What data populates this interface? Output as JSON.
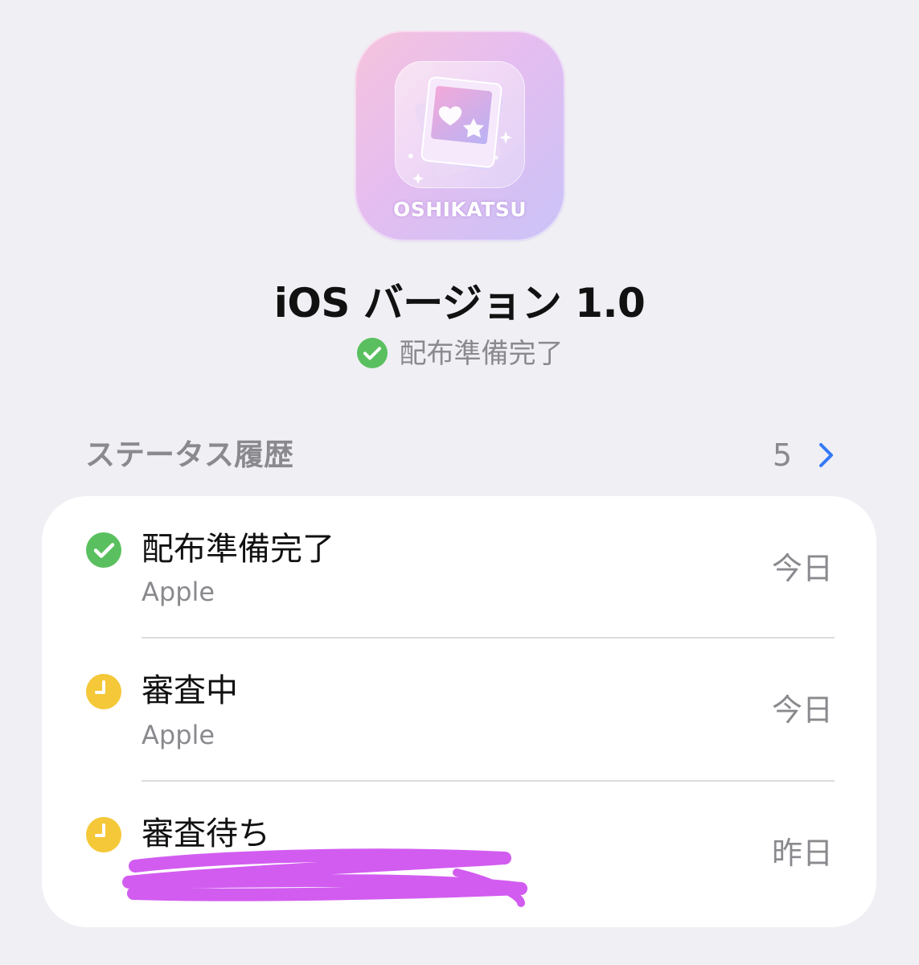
{
  "app": {
    "icon_label": "OSHIKATSU",
    "icon_colors": {
      "gradient_start": "#f6c3dc",
      "gradient_mid": "#e5bdf0",
      "gradient_end": "#c9c3f7"
    }
  },
  "header": {
    "version_title": "iOS バージョン 1.0",
    "status_text": "配布準備完了",
    "status_icon": "green-checkmark-icon"
  },
  "history": {
    "section_title": "ステータス履歴",
    "count": "5",
    "items": [
      {
        "title": "配布準備完了",
        "subtitle": "Apple",
        "date": "今日",
        "icon": "green-checkmark-icon"
      },
      {
        "title": "審査中",
        "subtitle": "Apple",
        "date": "今日",
        "icon": "yellow-clock-icon"
      },
      {
        "title": "審査待ち",
        "subtitle": "",
        "date": "昨日",
        "icon": "yellow-clock-icon"
      }
    ]
  },
  "colors": {
    "background": "#f0eff4",
    "success_green": "#5ac05f",
    "pending_yellow": "#f4c838",
    "accent_blue": "#3478f6",
    "secondary_text": "#8a8a8e",
    "redaction_purple": "#d25cf0"
  }
}
